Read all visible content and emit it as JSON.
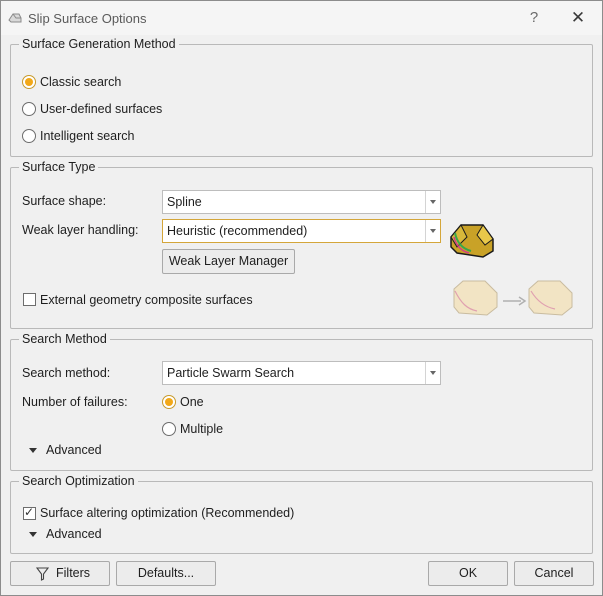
{
  "window": {
    "title": "Slip Surface Options",
    "help_label": "?",
    "close_label": "✕"
  },
  "surface_generation": {
    "legend": "Surface Generation Method",
    "options": [
      {
        "label": "Classic search",
        "checked": true
      },
      {
        "label": "User-defined surfaces",
        "checked": false
      },
      {
        "label": "Intelligent search",
        "checked": false
      }
    ]
  },
  "surface_type": {
    "legend": "Surface Type",
    "shape_label": "Surface shape:",
    "shape_value": "Spline",
    "weak_label": "Weak layer handling:",
    "weak_value": "Heuristic (recommended)",
    "weak_manager_label": "Weak Layer Manager",
    "external_label": "External geometry composite surfaces",
    "external_checked": false
  },
  "search_method": {
    "legend": "Search Method",
    "method_label": "Search method:",
    "method_value": "Particle Swarm Search",
    "failures_label": "Number of failures:",
    "failures_options": [
      {
        "label": "One",
        "checked": true
      },
      {
        "label": "Multiple",
        "checked": false
      }
    ],
    "advanced_label": "Advanced"
  },
  "search_optimization": {
    "legend": "Search Optimization",
    "altering_label": "Surface altering optimization (Recommended)",
    "altering_checked": true,
    "advanced_label": "Advanced"
  },
  "footer": {
    "filters_label": "Filters",
    "defaults_label": "Defaults...",
    "ok_label": "OK",
    "cancel_label": "Cancel"
  },
  "icons": {
    "app": "slip-surface-app-icon",
    "weak_layer": "weak-layer-slope-icon",
    "composite": "composite-surface-icon",
    "filter": "filter-funnel-icon"
  },
  "colors": {
    "accent": "#f2a818",
    "focus_border": "#d4a63a"
  }
}
